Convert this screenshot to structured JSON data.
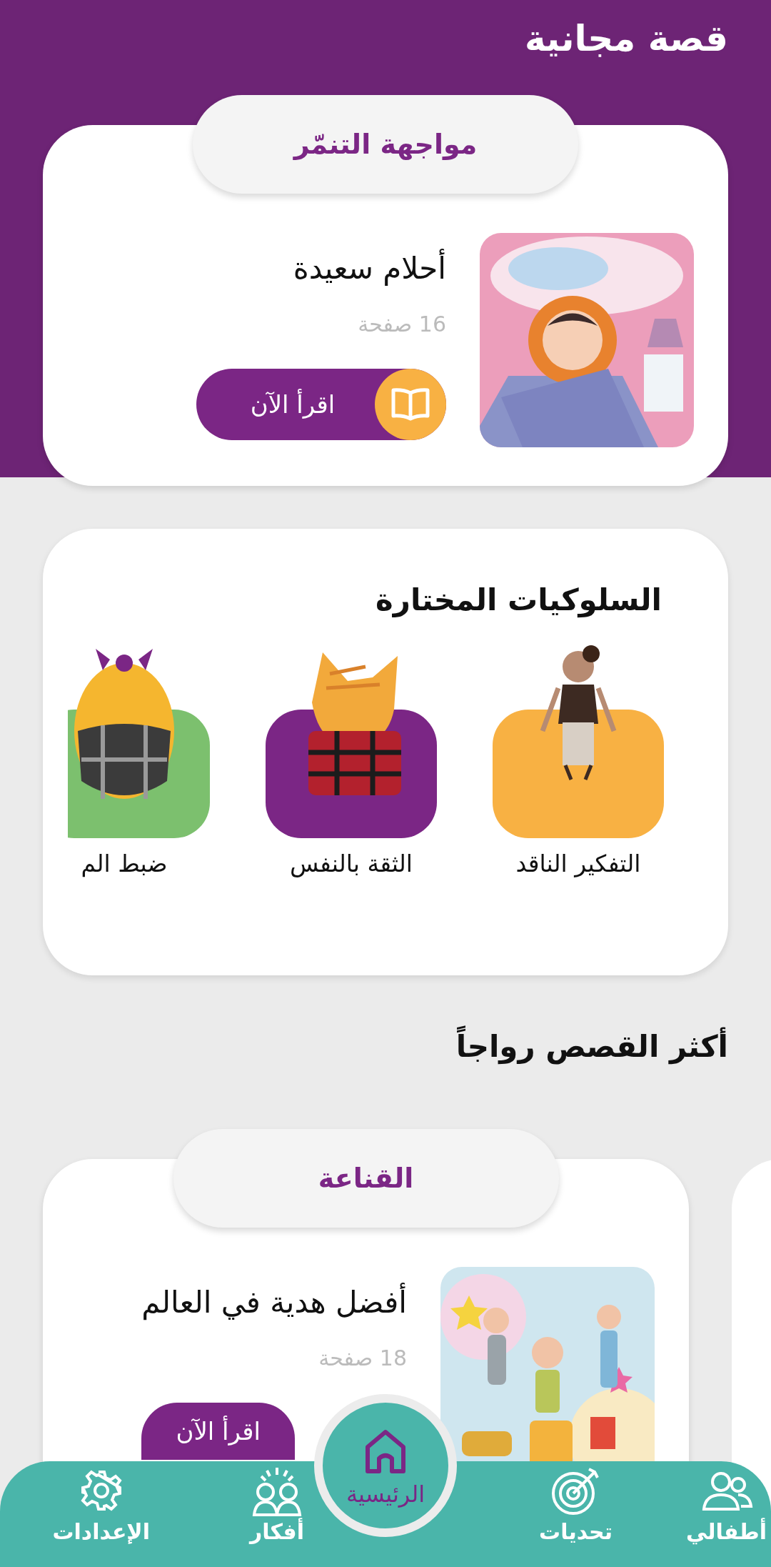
{
  "header": {
    "title": "قصة مجانية"
  },
  "featured": {
    "category": "مواجهة التنمّر",
    "title": "أحلام سعيدة",
    "pages": "16 صفحة",
    "button": "اقرأ الآن"
  },
  "behaviors": {
    "title": "السلوكيات المختارة",
    "items": [
      {
        "label": "التفكير الناقد",
        "color": "#f8b143"
      },
      {
        "label": "الثقة بالنفس",
        "color": "#7b2685"
      },
      {
        "label": "ضبط الم",
        "color": "#7cc06e"
      }
    ]
  },
  "popular": {
    "title": "أكثر القصص رواجاً",
    "stories": [
      {
        "category": "القناعة",
        "title": "أفضل هدية في العالم",
        "pages": "18 صفحة",
        "button": "اقرأ الآن"
      }
    ]
  },
  "nav": [
    {
      "label": "أطفالي",
      "selected": false
    },
    {
      "label": "تحديات",
      "selected": false
    },
    {
      "label": "الرئيسية",
      "selected": true
    },
    {
      "label": "أفكار",
      "selected": false
    },
    {
      "label": "الإعدادات",
      "selected": false
    }
  ]
}
